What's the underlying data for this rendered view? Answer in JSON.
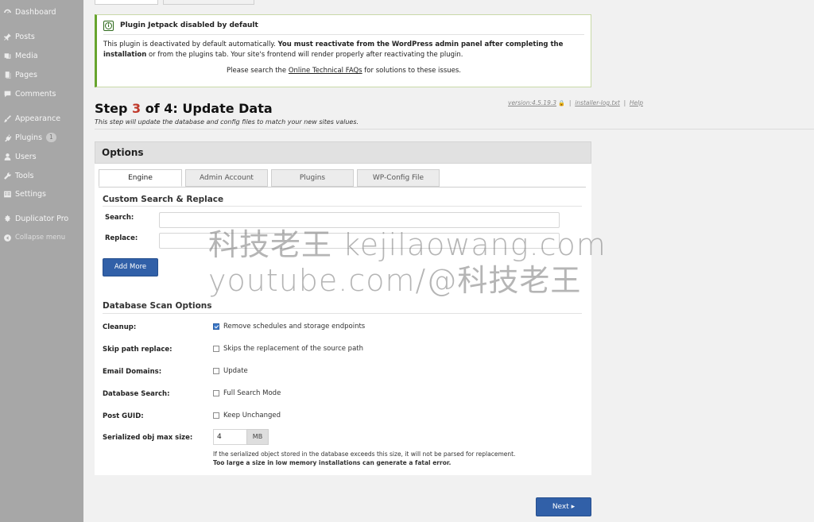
{
  "sidebar": {
    "items": [
      {
        "label": "Dashboard",
        "icon": "dashboard-icon"
      },
      {
        "label": "Posts",
        "icon": "pin-icon"
      },
      {
        "label": "Media",
        "icon": "media-icon"
      },
      {
        "label": "Pages",
        "icon": "pages-icon"
      },
      {
        "label": "Comments",
        "icon": "comment-icon"
      },
      {
        "label": "Appearance",
        "icon": "paintbrush-icon"
      },
      {
        "label": "Plugins",
        "icon": "plugin-icon",
        "badge": "1"
      },
      {
        "label": "Users",
        "icon": "user-icon"
      },
      {
        "label": "Tools",
        "icon": "wrench-icon"
      },
      {
        "label": "Settings",
        "icon": "settings-icon"
      },
      {
        "label": "Duplicator Pro",
        "icon": "duplicator-icon"
      },
      {
        "label": "Collapse menu",
        "icon": "collapse-icon"
      }
    ]
  },
  "notice": {
    "title": "Plugin Jetpack disabled by default",
    "body_start": "This plugin is deactivated by default automatically. ",
    "body_bold": "You must reactivate from the WordPress admin panel after completing the installation",
    "body_end": " or from the plugins tab. Your site's frontend will render properly after reactivating the plugin.",
    "faq_pre": "Please search the ",
    "faq_link": "Online Technical FAQs",
    "faq_post": " for solutions to these issues."
  },
  "step": {
    "prefix": "Step ",
    "number": "3",
    "suffix": " of 4: Update Data",
    "subtitle": "This step will update the database and config files to match your new sites values."
  },
  "meta": {
    "version": "version:4.5.19.3",
    "lock": "🔒",
    "sep": "|",
    "log": "installer-log.txt",
    "help": "Help"
  },
  "options": {
    "heading": "Options",
    "tabs": [
      "Engine",
      "Admin Account",
      "Plugins",
      "WP-Config File"
    ],
    "search_replace_title": "Custom Search & Replace",
    "search_label": "Search:",
    "replace_label": "Replace:",
    "search_value": "",
    "replace_value": "",
    "add_more": "Add More",
    "db_scan_title": "Database Scan Options",
    "rows": [
      {
        "label": "Cleanup:",
        "text": "Remove schedules and storage endpoints",
        "checked": true
      },
      {
        "label": "Skip path replace:",
        "text": "Skips the replacement of the source path",
        "checked": false
      },
      {
        "label": "Email Domains:",
        "text": "Update",
        "checked": false
      },
      {
        "label": "Database Search:",
        "text": "Full Search Mode",
        "checked": false
      },
      {
        "label": "Post GUID:",
        "text": "Keep Unchanged",
        "checked": false
      }
    ],
    "max_size_label": "Serialized obj max size:",
    "max_size_value": "4",
    "max_size_unit": "MB",
    "help_line1": "If the serialized object stored in the database exceeds this size, it will not be parsed for replacement.",
    "help_line2": "Too large a size in low memory installations can generate a fatal error."
  },
  "next_label": "Next ▸",
  "watermark": {
    "line1": "科技老王 kejilaowang.com",
    "line2": "youtube.com/@科技老王"
  },
  "colors": {
    "primary_button": "#3160a8",
    "notice_border": "#67a42d",
    "step_number": "#c0392b",
    "sidebar": "#a7a7a7"
  }
}
